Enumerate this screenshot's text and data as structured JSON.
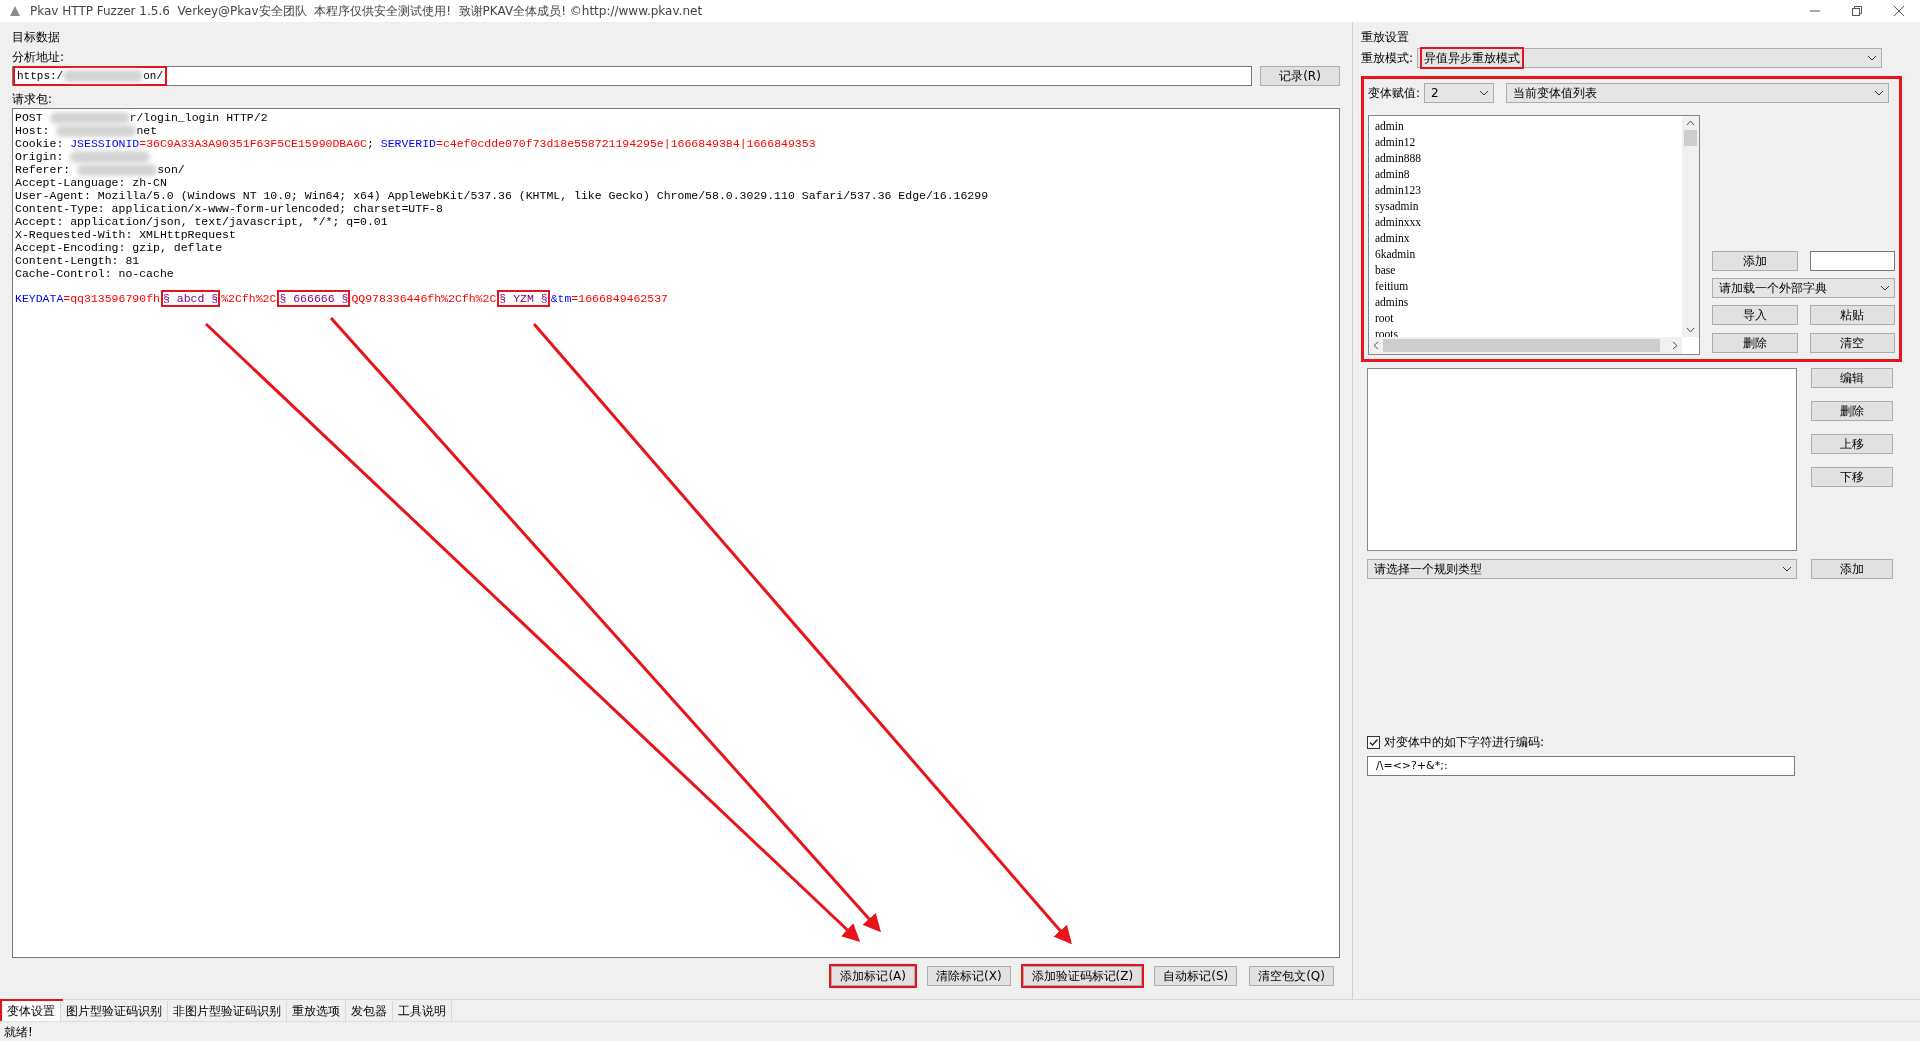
{
  "window": {
    "title": "Pkav HTTP Fuzzer 1.5.6  Verkey@Pkav安全团队  本程序仅供安全测试使用!  致谢PKAV全体成员! ©http://www.pkav.net"
  },
  "target": {
    "group_title": "目标数据",
    "url_label": "分析地址:",
    "url": {
      "highlighted": true,
      "segments": [
        {
          "kind": "plain",
          "text": "https:/"
        },
        {
          "kind": "blur"
        },
        {
          "kind": "plain",
          "text": "on/"
        }
      ]
    },
    "record_button": "记录(R)",
    "request_label": "请求包:",
    "request_lines": [
      [
        {
          "kind": "plain",
          "text": "POST "
        },
        {
          "kind": "blur"
        },
        {
          "kind": "plain",
          "text": "r/login_login HTTP/2"
        }
      ],
      [
        {
          "kind": "plain",
          "text": "Host: "
        },
        {
          "kind": "blur"
        },
        {
          "kind": "plain",
          "text": "net"
        }
      ],
      [
        {
          "kind": "plain",
          "text": "Cookie: "
        },
        {
          "kind": "key",
          "text": "JSESSIONID"
        },
        {
          "kind": "value",
          "text": "=36C9A33A3A90351F63F5CE15990DBA6C"
        },
        {
          "kind": "plain",
          "text": "; "
        },
        {
          "kind": "key",
          "text": "SERVERID"
        },
        {
          "kind": "value",
          "text": "=c4ef0cdde070f73d18e558721194295e|1666849384|1666849353"
        }
      ],
      [
        {
          "kind": "plain",
          "text": "Origin: "
        },
        {
          "kind": "blur"
        }
      ],
      [
        {
          "kind": "plain",
          "text": "Referer: "
        },
        {
          "kind": "blur"
        },
        {
          "kind": "plain",
          "text": "son/"
        }
      ],
      [
        {
          "kind": "plain",
          "text": "Accept-Language: zh-CN"
        }
      ],
      [
        {
          "kind": "plain",
          "text": "User-Agent: Mozilla/5.0 (Windows NT 10.0; Win64; x64) AppleWebKit/537.36 (KHTML, like Gecko) Chrome/58.0.3029.110 Safari/537.36 Edge/16.16299"
        }
      ],
      [
        {
          "kind": "plain",
          "text": "Content-Type: application/x-www-form-urlencoded; charset=UTF-8"
        }
      ],
      [
        {
          "kind": "plain",
          "text": "Accept: application/json, text/javascript, */*; q=0.01"
        }
      ],
      [
        {
          "kind": "plain",
          "text": "X-Requested-With: XMLHttpRequest"
        }
      ],
      [
        {
          "kind": "plain",
          "text": "Accept-Encoding: gzip, deflate"
        }
      ],
      [
        {
          "kind": "plain",
          "text": "Content-Length: 81"
        }
      ],
      [
        {
          "kind": "plain",
          "text": "Cache-Control: no-cache"
        }
      ]
    ],
    "request_body": [
      {
        "kind": "key",
        "text": "KEYDATA"
      },
      {
        "kind": "value",
        "text": "=qq313596790fh"
      },
      {
        "kind": "marker",
        "text": "§ abcd §",
        "highlighted": true
      },
      {
        "kind": "value",
        "text": "%2Cfh%2C"
      },
      {
        "kind": "marker",
        "text": "§ 666666 §",
        "highlighted": true
      },
      {
        "kind": "value",
        "text": "QQ978336446fh%2Cfh%2C"
      },
      {
        "kind": "marker",
        "text": "§ YZM §",
        "highlighted": true
      },
      {
        "kind": "key",
        "text": "&tm"
      },
      {
        "kind": "value",
        "text": "=1666849462537"
      }
    ],
    "action_buttons": [
      {
        "label": "添加标记(A)",
        "highlighted": true
      },
      {
        "label": "清除标记(X)",
        "highlighted": false
      },
      {
        "label": "添加验证码标记(Z)",
        "highlighted": true
      },
      {
        "label": "自动标记(S)",
        "highlighted": false
      },
      {
        "label": "清空包文(Q)",
        "highlighted": false
      }
    ]
  },
  "replay": {
    "group_title": "重放设置",
    "mode_label": "重放模式:",
    "mode": {
      "value": "异值异步重放模式",
      "highlighted": true
    },
    "variant": {
      "highlighted": true,
      "label": "变体赋值:",
      "index": "2",
      "source": "当前变体值列表",
      "values": [
        "admin",
        "admin12",
        "admin888",
        "admin8",
        "admin123",
        "sysadmin",
        "adminxxx",
        "adminx",
        "6kadmin",
        "base",
        "feitium",
        "admins",
        "root",
        "roots"
      ],
      "add_button": "添加",
      "dictionary": "请加载一个外部字典",
      "buttons": [
        "导入",
        "粘贴",
        "删除",
        "清空"
      ]
    },
    "rule_buttons": [
      "编辑",
      "删除",
      "上移",
      "下移"
    ],
    "rule_type": "请选择一个规则类型",
    "rule_add": "添加",
    "encode": {
      "label": "对变体中的如下字符进行编码:",
      "checked": true,
      "chars": "/\\=<>?+&*;:"
    }
  },
  "tabs": [
    {
      "label": "变体设置",
      "selected": true,
      "highlighted": true
    },
    {
      "label": "图片型验证码识别",
      "selected": false,
      "highlighted": false
    },
    {
      "label": "非图片型验证码识别",
      "selected": false,
      "highlighted": false
    },
    {
      "label": "重放选项",
      "selected": false,
      "highlighted": false
    },
    {
      "label": "发包器",
      "selected": false,
      "highlighted": false
    },
    {
      "label": "工具说明",
      "selected": false,
      "highlighted": false
    }
  ],
  "status": "就绪!"
}
